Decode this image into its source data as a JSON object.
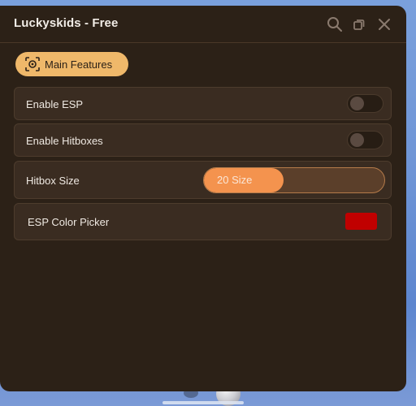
{
  "window": {
    "title": "Luckyskids - Free",
    "controls": [
      {
        "name": "search-icon"
      },
      {
        "name": "restore-icon"
      },
      {
        "name": "close-icon"
      }
    ]
  },
  "tabs": [
    {
      "label": "Main Features",
      "icon": "feature-icon",
      "selected": true
    }
  ],
  "settings": {
    "esp": {
      "label": "Enable ESP",
      "enabled": false
    },
    "hitboxes": {
      "label": "Enable Hitboxes",
      "enabled": false
    },
    "hitbox_size": {
      "label": "Hitbox Size",
      "value_text": "20 Size",
      "fill_fraction": 0.44
    },
    "esp_color": {
      "label": "ESP Color Picker",
      "color": "#c00000"
    }
  },
  "colors": {
    "window_bg": "#2c2117",
    "accent": "#efb86a",
    "slider_fill": "#f4934e"
  }
}
